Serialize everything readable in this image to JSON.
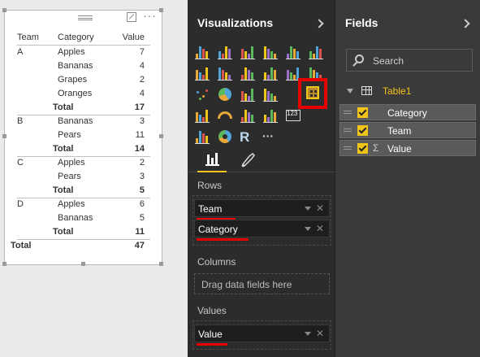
{
  "matrix": {
    "headers": {
      "team": "Team",
      "category": "Category",
      "value": "Value"
    },
    "rows": [
      {
        "team": "A",
        "category": "Apples",
        "value": "7",
        "bold": false
      },
      {
        "team": "",
        "category": "Bananas",
        "value": "4",
        "bold": false
      },
      {
        "team": "",
        "category": "Grapes",
        "value": "2",
        "bold": false
      },
      {
        "team": "",
        "category": "Oranges",
        "value": "4",
        "bold": false
      },
      {
        "team": "",
        "category": "Total",
        "value": "17",
        "bold": true
      },
      {
        "team": "B",
        "category": "Bananas",
        "value": "3",
        "bold": false
      },
      {
        "team": "",
        "category": "Pears",
        "value": "11",
        "bold": false
      },
      {
        "team": "",
        "category": "Total",
        "value": "14",
        "bold": true
      },
      {
        "team": "C",
        "category": "Apples",
        "value": "2",
        "bold": false
      },
      {
        "team": "",
        "category": "Pears",
        "value": "3",
        "bold": false
      },
      {
        "team": "",
        "category": "Total",
        "value": "5",
        "bold": true
      },
      {
        "team": "D",
        "category": "Apples",
        "value": "6",
        "bold": false
      },
      {
        "team": "",
        "category": "Bananas",
        "value": "5",
        "bold": false
      },
      {
        "team": "",
        "category": "Total",
        "value": "11",
        "bold": true
      }
    ],
    "grand_total": {
      "label": "Total",
      "value": "47"
    }
  },
  "visualizations": {
    "title": "Visualizations",
    "extra_label": "123",
    "r_label": "R",
    "more_label": "···",
    "sections": {
      "rows_label": "Rows",
      "columns_label": "Columns",
      "values_label": "Values",
      "columns_placeholder": "Drag data fields here"
    },
    "rows_fields": [
      "Team",
      "Category"
    ],
    "values_fields": [
      "Value"
    ],
    "accent_color": "#f0c419",
    "highlight_color": "#e60000"
  },
  "fields_pane": {
    "title": "Fields",
    "search_placeholder": "Search",
    "table_name": "Table1",
    "fields": [
      {
        "name": "Category",
        "checked": true,
        "sigma": false
      },
      {
        "name": "Team",
        "checked": true,
        "sigma": false
      },
      {
        "name": "Value",
        "checked": true,
        "sigma": true
      }
    ]
  }
}
